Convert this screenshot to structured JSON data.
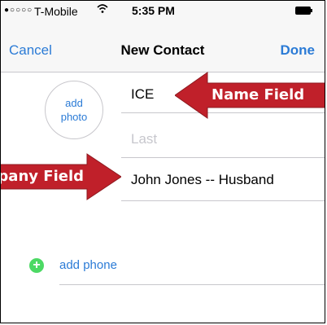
{
  "status_bar": {
    "signal": "●○○○○",
    "carrier": "T-Mobile",
    "wifi_icon": "wifi-icon",
    "time": "5:35 PM",
    "battery_icon": "battery-icon"
  },
  "nav": {
    "cancel_label": "Cancel",
    "title": "New Contact",
    "done_label": "Done"
  },
  "photo": {
    "line1": "add",
    "line2": "photo"
  },
  "fields": {
    "first_value": "ICE",
    "last_placeholder": "Last",
    "company_value": "John Jones -- Husband"
  },
  "phone": {
    "icon": "plus-icon",
    "label": "add phone"
  },
  "annotations": {
    "name_field": "Name Field",
    "company_field": "Company Field"
  },
  "colors": {
    "accent": "#2b7bd6",
    "callout": "#c0202a",
    "add_green": "#4cd964",
    "separator": "#c8c7cc"
  }
}
